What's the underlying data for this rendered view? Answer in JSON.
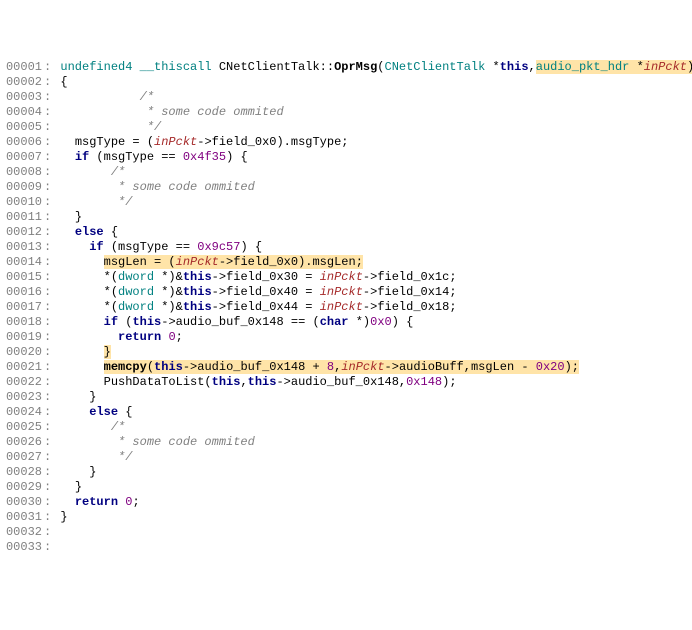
{
  "lines": [
    {
      "no": "00001",
      "segs": [
        {
          "t": " ",
          "c": ""
        },
        {
          "t": "undefined4",
          "c": "type"
        },
        {
          "t": " ",
          "c": ""
        },
        {
          "t": "__thiscall",
          "c": "type"
        },
        {
          "t": " ",
          "c": ""
        },
        {
          "t": "CNetClientTalk",
          "c": "ident"
        },
        {
          "t": "::",
          "c": "punc"
        },
        {
          "t": "OprMsg",
          "c": "func"
        },
        {
          "t": "(",
          "c": "punc"
        },
        {
          "t": "CNetClientTalk",
          "c": "type"
        },
        {
          "t": " *",
          "c": "punc"
        },
        {
          "t": "this",
          "c": "kw"
        },
        {
          "t": ",",
          "c": "punc"
        },
        {
          "t": "audio_pkt_hdr",
          "c": "type",
          "hl": true
        },
        {
          "t": " *",
          "c": "punc",
          "hl": true
        },
        {
          "t": "inPckt",
          "c": "param",
          "hl": true
        },
        {
          "t": ")",
          "c": "punc",
          "hl": true
        }
      ]
    },
    {
      "no": "00002",
      "segs": [
        {
          "t": " ",
          "c": ""
        },
        {
          "t": "{",
          "c": "punc"
        }
      ]
    },
    {
      "no": "00003",
      "segs": [
        {
          "t": "            ",
          "c": ""
        },
        {
          "t": "/*",
          "c": "comment"
        }
      ]
    },
    {
      "no": "00004",
      "segs": [
        {
          "t": "             ",
          "c": ""
        },
        {
          "t": "* some code ommited",
          "c": "comment"
        }
      ]
    },
    {
      "no": "00005",
      "segs": [
        {
          "t": "             ",
          "c": ""
        },
        {
          "t": "*/",
          "c": "comment"
        }
      ]
    },
    {
      "no": "00006",
      "segs": [
        {
          "t": "   ",
          "c": ""
        },
        {
          "t": "msgType = (",
          "c": "ident"
        },
        {
          "t": "inPckt",
          "c": "param"
        },
        {
          "t": "->",
          "c": "op"
        },
        {
          "t": "field_0x0",
          "c": "ident"
        },
        {
          "t": ").",
          "c": "punc"
        },
        {
          "t": "msgType",
          "c": "ident"
        },
        {
          "t": ";",
          "c": "punc"
        }
      ]
    },
    {
      "no": "00007",
      "segs": [
        {
          "t": "   ",
          "c": ""
        },
        {
          "t": "if",
          "c": "kw"
        },
        {
          "t": " (msgType == ",
          "c": "ident"
        },
        {
          "t": "0x4f35",
          "c": "num"
        },
        {
          "t": ") {",
          "c": "punc"
        }
      ]
    },
    {
      "no": "00008",
      "segs": [
        {
          "t": "        ",
          "c": ""
        },
        {
          "t": "/*",
          "c": "comment"
        }
      ]
    },
    {
      "no": "00009",
      "segs": [
        {
          "t": "         ",
          "c": ""
        },
        {
          "t": "* some code ommited",
          "c": "comment"
        }
      ]
    },
    {
      "no": "00010",
      "segs": [
        {
          "t": "         ",
          "c": ""
        },
        {
          "t": "*/",
          "c": "comment"
        }
      ]
    },
    {
      "no": "00011",
      "segs": [
        {
          "t": "   ",
          "c": ""
        },
        {
          "t": "}",
          "c": "punc"
        }
      ]
    },
    {
      "no": "00012",
      "segs": [
        {
          "t": "   ",
          "c": ""
        },
        {
          "t": "else",
          "c": "kw"
        },
        {
          "t": " {",
          "c": "punc"
        }
      ]
    },
    {
      "no": "00013",
      "segs": [
        {
          "t": "     ",
          "c": ""
        },
        {
          "t": "if",
          "c": "kw"
        },
        {
          "t": " (msgType == ",
          "c": "ident"
        },
        {
          "t": "0x9c57",
          "c": "num"
        },
        {
          "t": ") {",
          "c": "punc"
        }
      ]
    },
    {
      "no": "00014",
      "segs": [
        {
          "t": "       ",
          "c": ""
        },
        {
          "t": "msgLen = (",
          "c": "ident",
          "hl": true
        },
        {
          "t": "inPckt",
          "c": "param",
          "hl": true
        },
        {
          "t": "->",
          "c": "op",
          "hl": true
        },
        {
          "t": "field_0x0",
          "c": "ident",
          "hl": true
        },
        {
          "t": ").",
          "c": "punc",
          "hl": true
        },
        {
          "t": "msgLen",
          "c": "ident",
          "hl": true
        },
        {
          "t": ";",
          "c": "punc",
          "hl": true
        }
      ]
    },
    {
      "no": "00015",
      "segs": [
        {
          "t": "       *(",
          "c": "ident"
        },
        {
          "t": "dword",
          "c": "type"
        },
        {
          "t": " *)&",
          "c": "punc"
        },
        {
          "t": "this",
          "c": "kw"
        },
        {
          "t": "->",
          "c": "op"
        },
        {
          "t": "field_0x30",
          "c": "ident"
        },
        {
          "t": " = ",
          "c": "punc"
        },
        {
          "t": "inPckt",
          "c": "param"
        },
        {
          "t": "->",
          "c": "op"
        },
        {
          "t": "field_0x1c",
          "c": "ident"
        },
        {
          "t": ";",
          "c": "punc"
        }
      ]
    },
    {
      "no": "00016",
      "segs": [
        {
          "t": "       *(",
          "c": "ident"
        },
        {
          "t": "dword",
          "c": "type"
        },
        {
          "t": " *)&",
          "c": "punc"
        },
        {
          "t": "this",
          "c": "kw"
        },
        {
          "t": "->",
          "c": "op"
        },
        {
          "t": "field_0x40",
          "c": "ident"
        },
        {
          "t": " = ",
          "c": "punc"
        },
        {
          "t": "inPckt",
          "c": "param"
        },
        {
          "t": "->",
          "c": "op"
        },
        {
          "t": "field_0x14",
          "c": "ident"
        },
        {
          "t": ";",
          "c": "punc"
        }
      ]
    },
    {
      "no": "00017",
      "segs": [
        {
          "t": "       *(",
          "c": "ident"
        },
        {
          "t": "dword",
          "c": "type"
        },
        {
          "t": " *)&",
          "c": "punc"
        },
        {
          "t": "this",
          "c": "kw"
        },
        {
          "t": "->",
          "c": "op"
        },
        {
          "t": "field_0x44",
          "c": "ident"
        },
        {
          "t": " = ",
          "c": "punc"
        },
        {
          "t": "inPckt",
          "c": "param"
        },
        {
          "t": "->",
          "c": "op"
        },
        {
          "t": "field_0x18",
          "c": "ident"
        },
        {
          "t": ";",
          "c": "punc"
        }
      ]
    },
    {
      "no": "00018",
      "segs": [
        {
          "t": "       ",
          "c": ""
        },
        {
          "t": "if",
          "c": "kw"
        },
        {
          "t": " (",
          "c": "punc"
        },
        {
          "t": "this",
          "c": "kw"
        },
        {
          "t": "->",
          "c": "op"
        },
        {
          "t": "audio_buf_0x148",
          "c": "ident"
        },
        {
          "t": " == (",
          "c": "punc"
        },
        {
          "t": "char",
          "c": "kw"
        },
        {
          "t": " *)",
          "c": "punc"
        },
        {
          "t": "0x0",
          "c": "num"
        },
        {
          "t": ") {",
          "c": "punc"
        }
      ]
    },
    {
      "no": "00019",
      "segs": [
        {
          "t": "         ",
          "c": ""
        },
        {
          "t": "return",
          "c": "kw"
        },
        {
          "t": " ",
          "c": ""
        },
        {
          "t": "0",
          "c": "num"
        },
        {
          "t": ";",
          "c": "punc"
        }
      ]
    },
    {
      "no": "00020",
      "segs": [
        {
          "t": "       ",
          "c": ""
        },
        {
          "t": "}",
          "c": "punc",
          "hl": true
        }
      ]
    },
    {
      "no": "00021",
      "segs": [
        {
          "t": "       ",
          "c": ""
        },
        {
          "t": "memcpy",
          "c": "func",
          "hl": true
        },
        {
          "t": "(",
          "c": "punc",
          "hl": true
        },
        {
          "t": "this",
          "c": "kw",
          "hl": true
        },
        {
          "t": "->",
          "c": "op",
          "hl": true
        },
        {
          "t": "audio_buf_0x148",
          "c": "ident",
          "hl": true
        },
        {
          "t": " + ",
          "c": "punc",
          "hl": true
        },
        {
          "t": "8",
          "c": "num",
          "hl": true
        },
        {
          "t": ",",
          "c": "punc",
          "hl": true
        },
        {
          "t": "inPckt",
          "c": "param",
          "hl": true
        },
        {
          "t": "->",
          "c": "op",
          "hl": true
        },
        {
          "t": "audioBuff",
          "c": "ident",
          "hl": true
        },
        {
          "t": ",",
          "c": "punc",
          "hl": true
        },
        {
          "t": "msgLen - ",
          "c": "ident",
          "hl": true
        },
        {
          "t": "0x20",
          "c": "num",
          "hl": true
        },
        {
          "t": ");",
          "c": "punc",
          "hl": true
        }
      ]
    },
    {
      "no": "00022",
      "segs": [
        {
          "t": "       PushDataToList(",
          "c": "ident"
        },
        {
          "t": "this",
          "c": "kw"
        },
        {
          "t": ",",
          "c": "punc"
        },
        {
          "t": "this",
          "c": "kw"
        },
        {
          "t": "->",
          "c": "op"
        },
        {
          "t": "audio_buf_0x148",
          "c": "ident"
        },
        {
          "t": ",",
          "c": "punc"
        },
        {
          "t": "0x148",
          "c": "num"
        },
        {
          "t": ");",
          "c": "punc"
        }
      ]
    },
    {
      "no": "00023",
      "segs": [
        {
          "t": "     ",
          "c": ""
        },
        {
          "t": "}",
          "c": "punc"
        }
      ]
    },
    {
      "no": "00024",
      "segs": [
        {
          "t": "     ",
          "c": ""
        },
        {
          "t": "else",
          "c": "kw"
        },
        {
          "t": " {",
          "c": "punc"
        }
      ]
    },
    {
      "no": "00025",
      "segs": [
        {
          "t": "        ",
          "c": ""
        },
        {
          "t": "/*",
          "c": "comment"
        }
      ]
    },
    {
      "no": "00026",
      "segs": [
        {
          "t": "         ",
          "c": ""
        },
        {
          "t": "* some code ommited",
          "c": "comment"
        }
      ]
    },
    {
      "no": "00027",
      "segs": [
        {
          "t": "         ",
          "c": ""
        },
        {
          "t": "*/",
          "c": "comment"
        }
      ]
    },
    {
      "no": "00028",
      "segs": [
        {
          "t": "     ",
          "c": ""
        },
        {
          "t": "}",
          "c": "punc"
        }
      ]
    },
    {
      "no": "00029",
      "segs": [
        {
          "t": "   ",
          "c": ""
        },
        {
          "t": "}",
          "c": "punc"
        }
      ]
    },
    {
      "no": "00030",
      "segs": [
        {
          "t": "   ",
          "c": ""
        },
        {
          "t": "return",
          "c": "kw"
        },
        {
          "t": " ",
          "c": ""
        },
        {
          "t": "0",
          "c": "num"
        },
        {
          "t": ";",
          "c": "punc"
        }
      ]
    },
    {
      "no": "00031",
      "segs": [
        {
          "t": " ",
          "c": ""
        },
        {
          "t": "}",
          "c": "punc"
        }
      ]
    },
    {
      "no": "00032",
      "segs": []
    },
    {
      "no": "00033",
      "segs": []
    }
  ]
}
